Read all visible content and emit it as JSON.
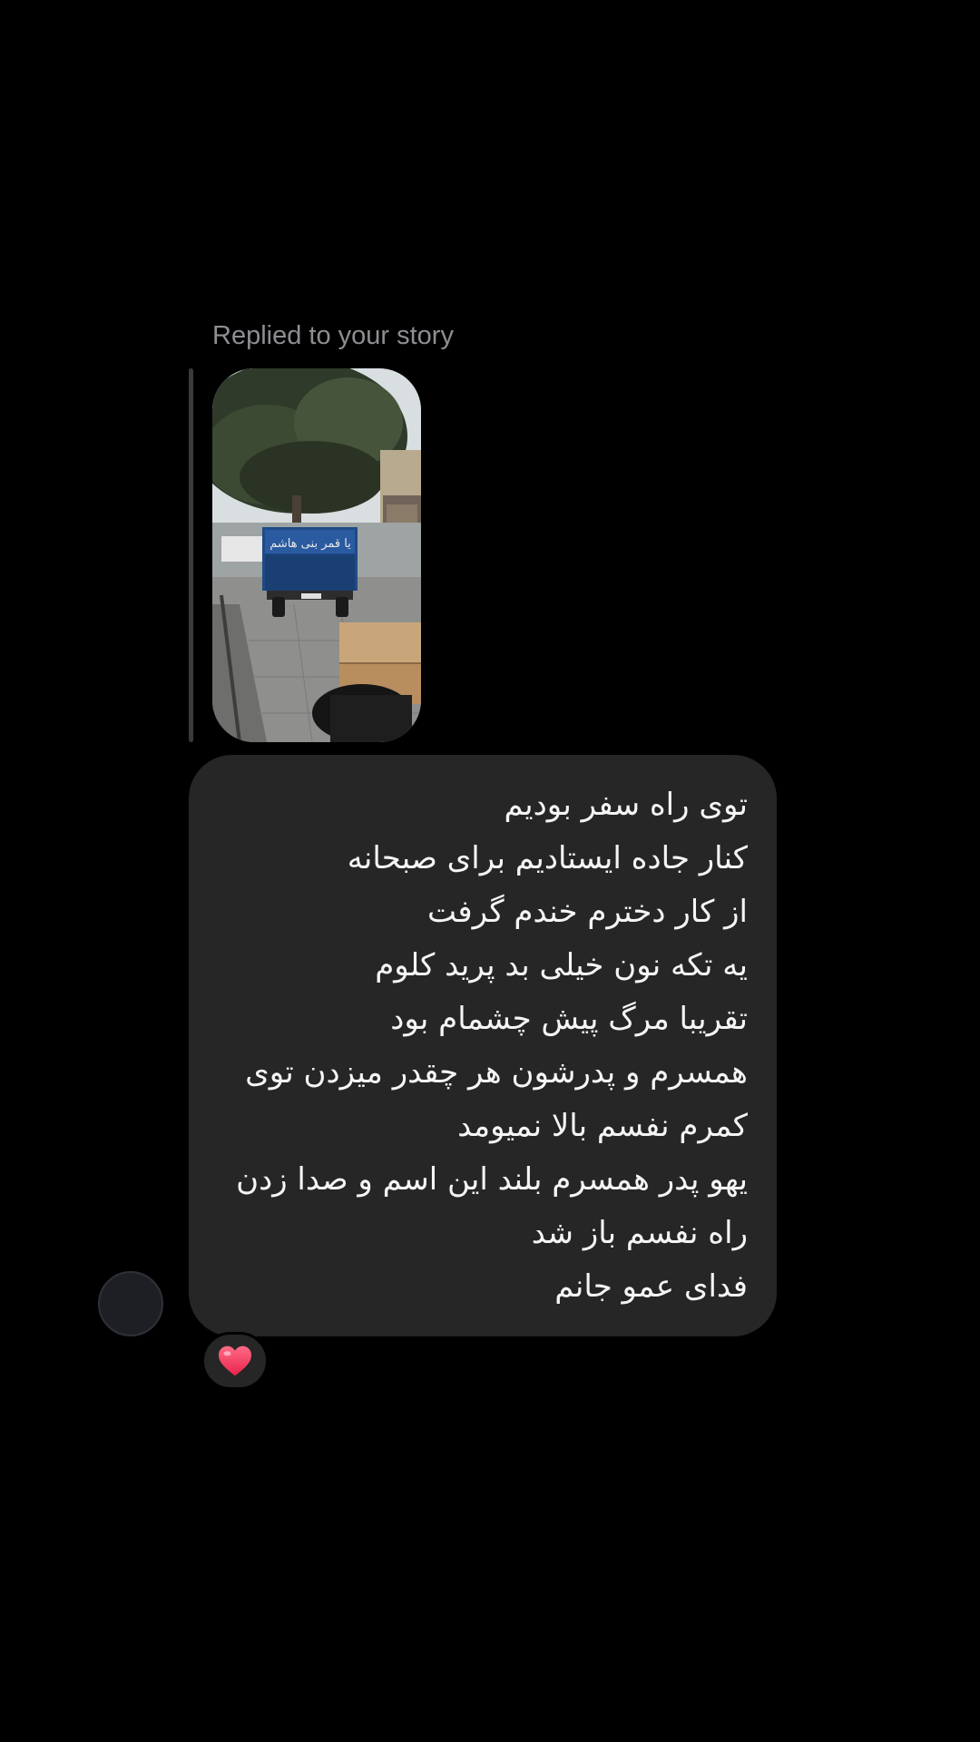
{
  "reply": {
    "caption": "Replied to your story"
  },
  "story": {
    "thumbnail_icon": "story-photo",
    "vehicle_sign_text": "یا قمر بنی هاشم"
  },
  "message": {
    "lines": [
      "توی راه سفر بودیم",
      "کنار جاده ایستادیم برای صبحانه",
      "از کار دخترم خندم گرفت",
      "یه تکه نون خیلی بد پرید کلوم",
      "تقریبا مرگ پیش چشمام بود",
      "همسرم و پدرشون هر چقدر میزدن توی",
      "کمرم نفسم بالا نمیومد",
      "یهو پدر همسرم بلند این اسم و صدا زدن",
      "راه نفسم باز شد",
      "فدای عمو جانم"
    ]
  },
  "reaction": {
    "icon": "heart-icon",
    "color": "#ff3b5c"
  },
  "colors": {
    "background": "#000000",
    "bubble": "#262626",
    "text": "#f5f5f5",
    "caption": "#8e8e93"
  }
}
